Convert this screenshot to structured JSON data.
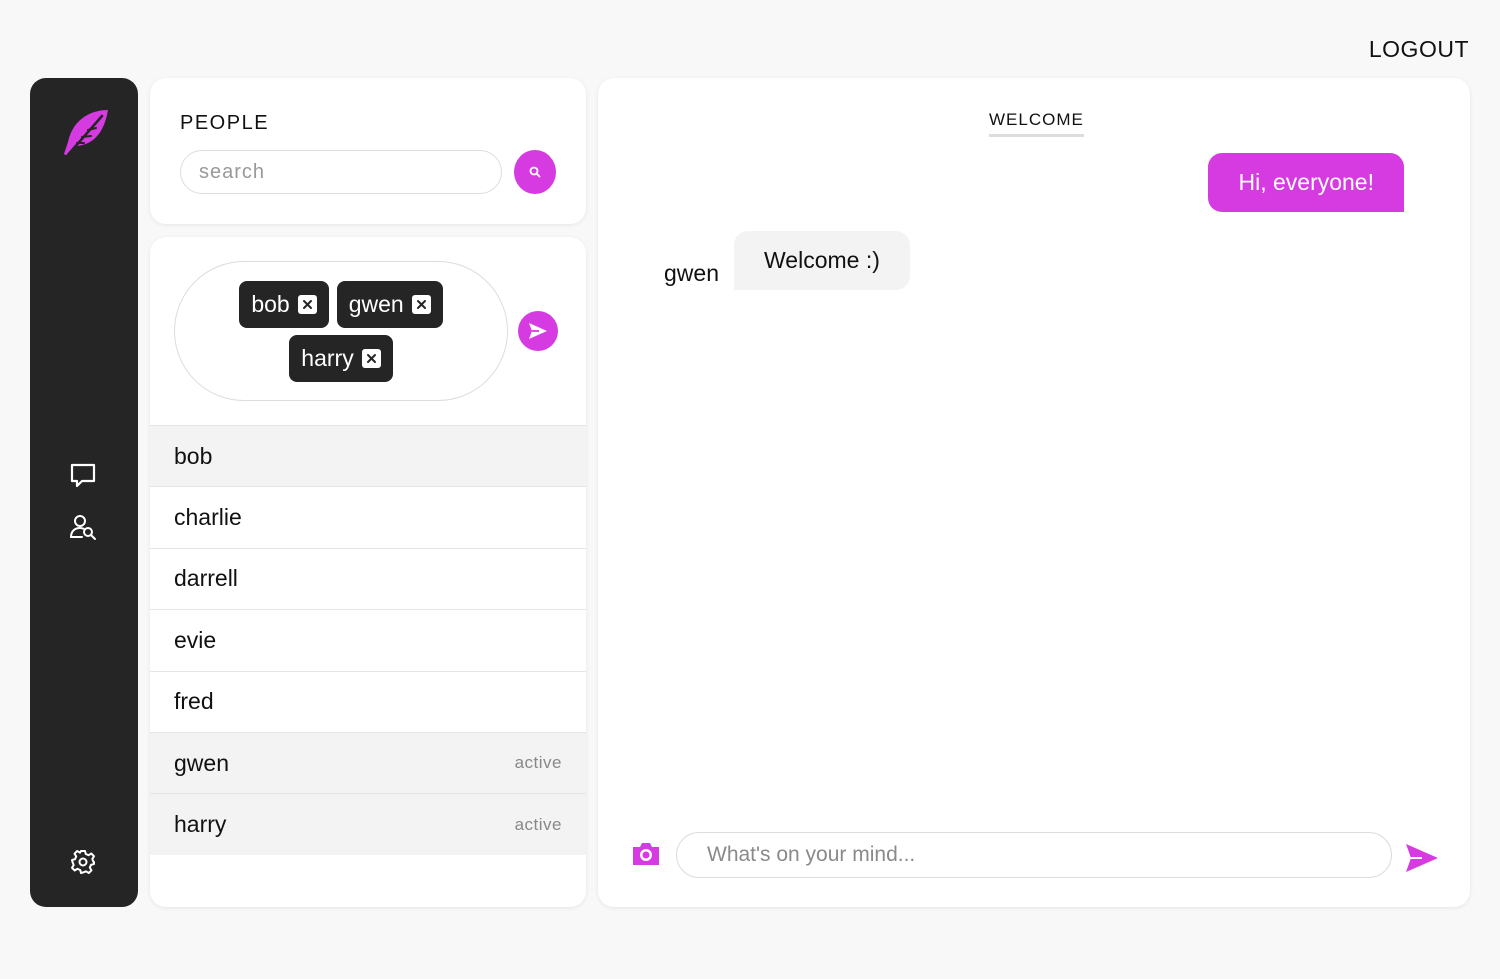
{
  "header": {
    "logout_label": "LOGOUT"
  },
  "theme": {
    "accent": "#d53be0",
    "sidebar_bg": "#252525",
    "page_bg": "#f8f8f8"
  },
  "sidebar": {
    "icons": [
      "feather-logo",
      "chat-bubble-icon",
      "user-search-icon",
      "gear-icon"
    ]
  },
  "people": {
    "title": "PEOPLE",
    "search": {
      "placeholder": "search",
      "value": ""
    },
    "selected_chips": [
      "bob",
      "gwen",
      "harry"
    ],
    "list": [
      {
        "name": "bob",
        "status": "",
        "selected": true
      },
      {
        "name": "charlie",
        "status": "",
        "selected": false
      },
      {
        "name": "darrell",
        "status": "",
        "selected": false
      },
      {
        "name": "evie",
        "status": "",
        "selected": false
      },
      {
        "name": "fred",
        "status": "",
        "selected": false
      },
      {
        "name": "gwen",
        "status": "active",
        "selected": true
      },
      {
        "name": "harry",
        "status": "active",
        "selected": true
      }
    ]
  },
  "chat": {
    "title": "WELCOME",
    "messages": [
      {
        "author": "",
        "text": "Hi, everyone!",
        "outgoing": true
      },
      {
        "author": "gwen",
        "text": "Welcome :)",
        "outgoing": false
      }
    ],
    "composer": {
      "placeholder": "What's on your mind...",
      "value": ""
    }
  }
}
